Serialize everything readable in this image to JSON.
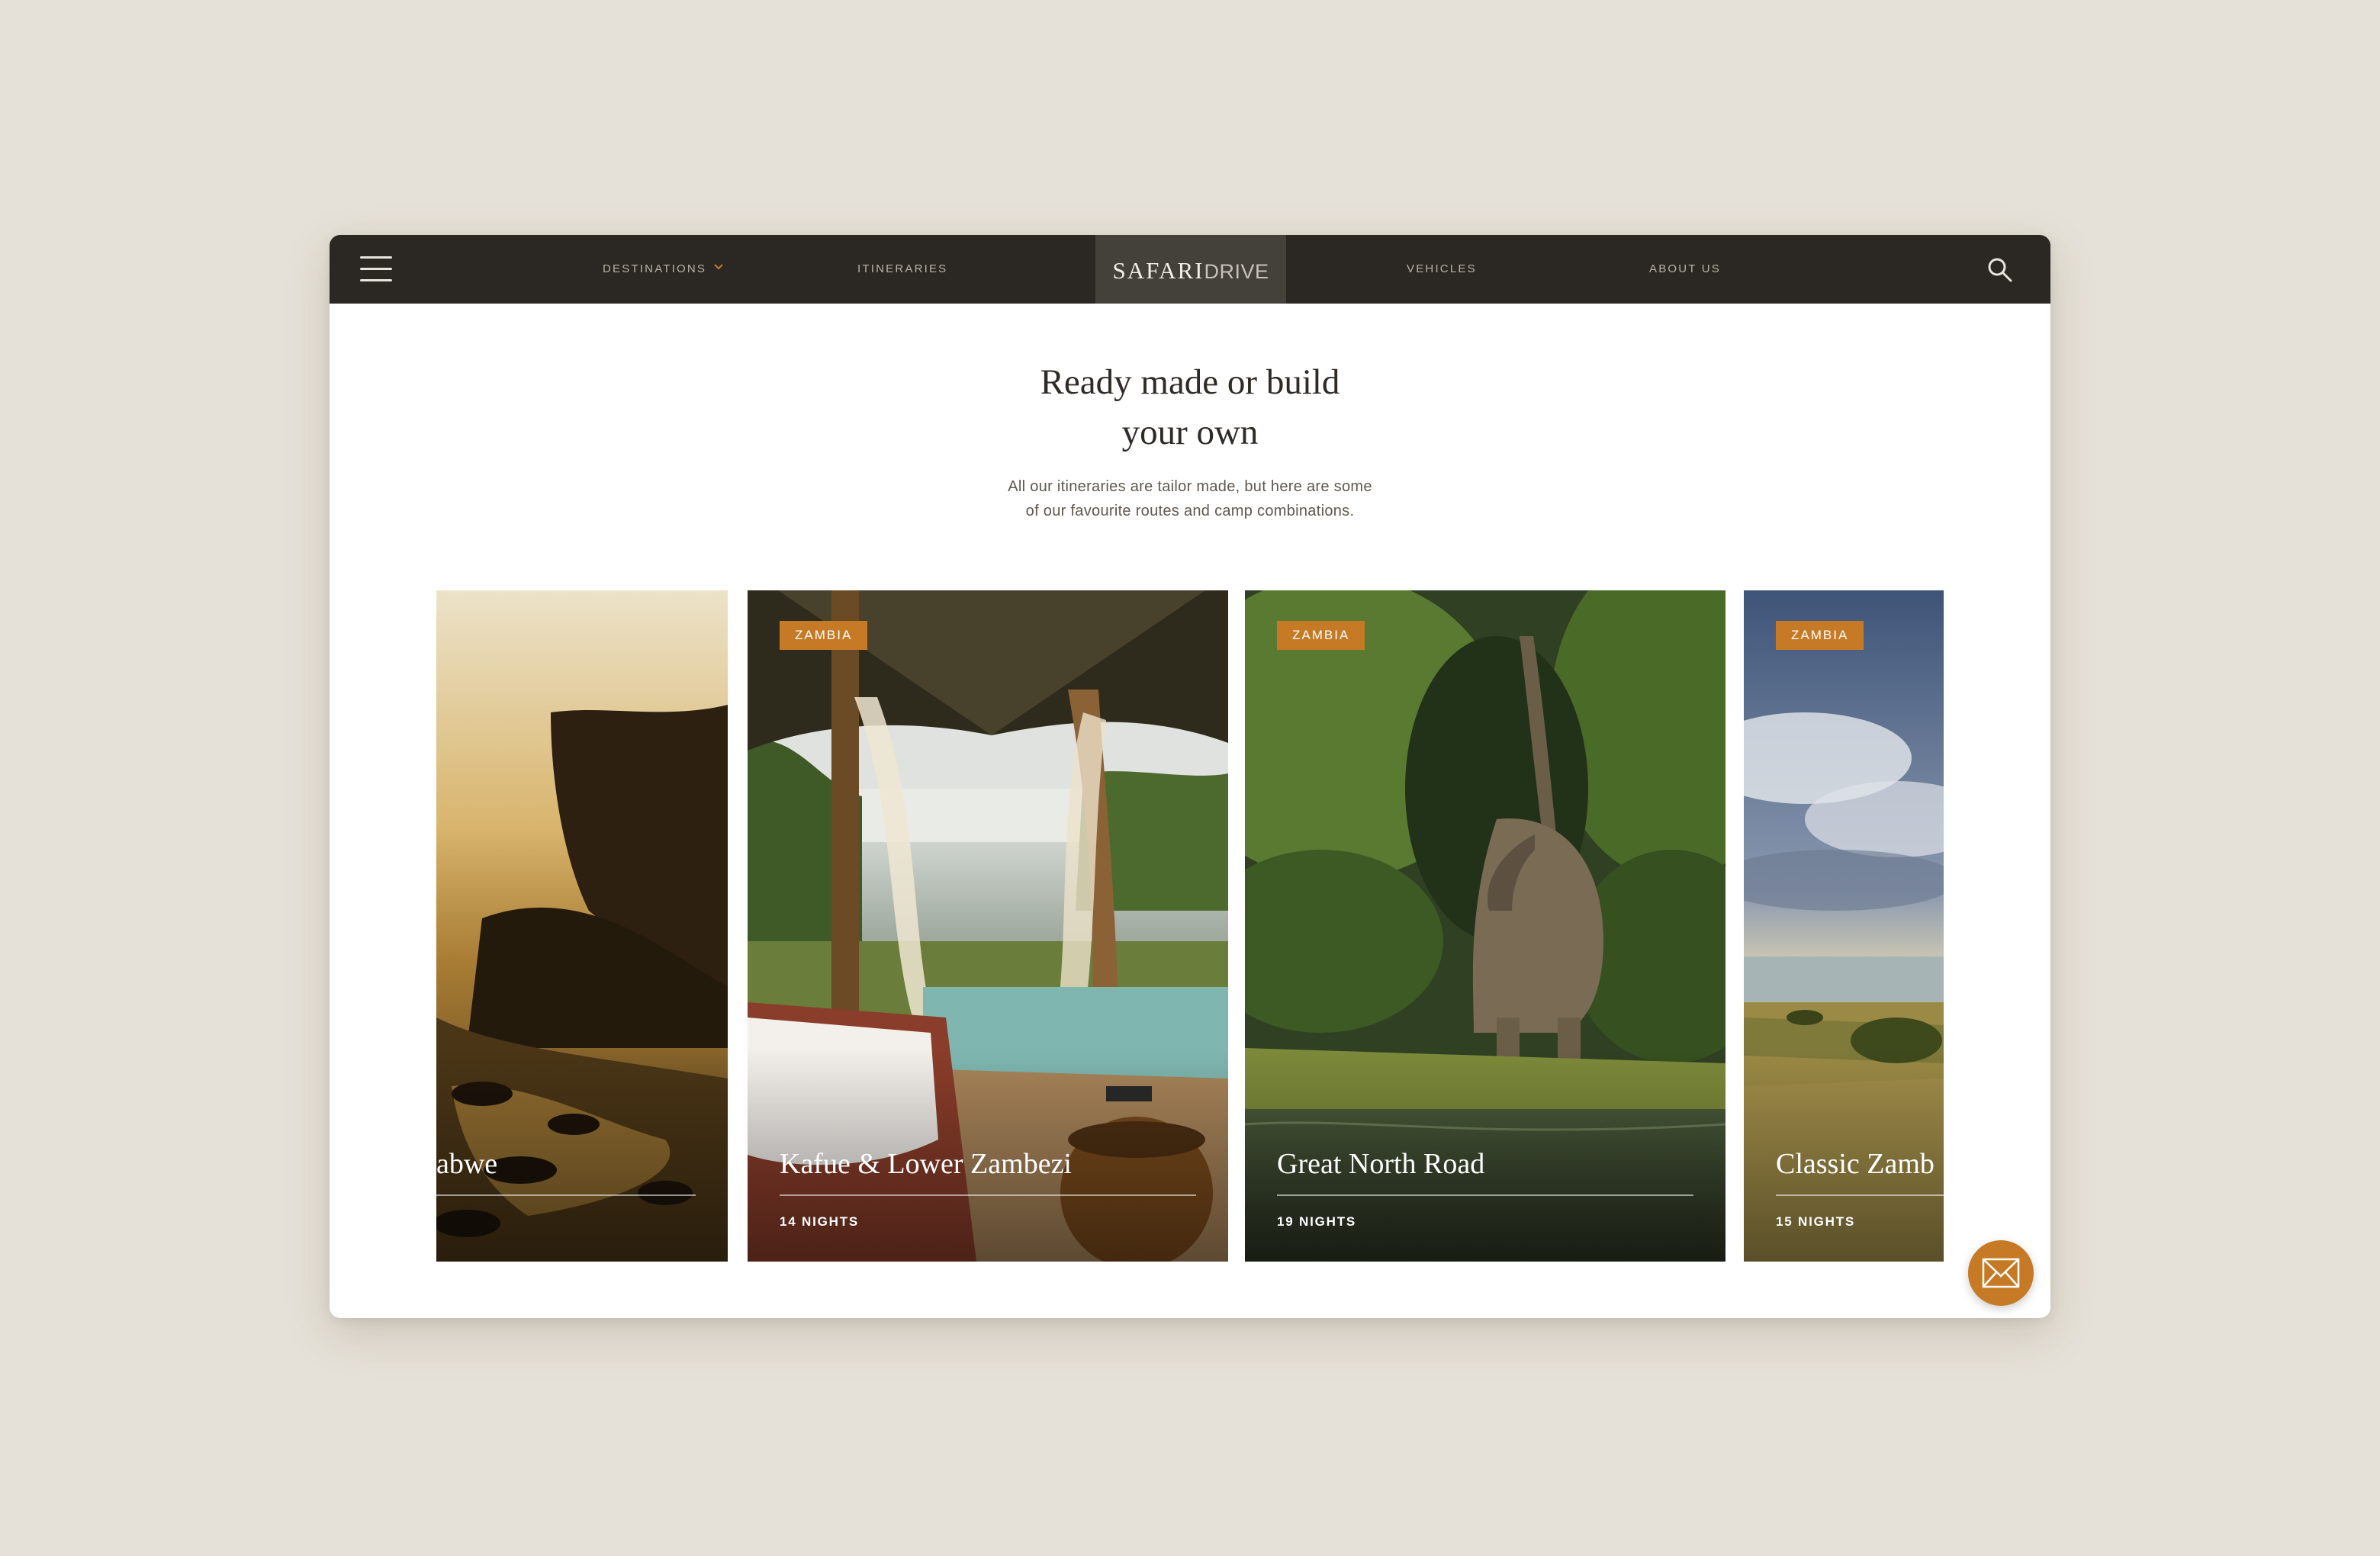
{
  "nav": {
    "links": {
      "destinations": "DESTINATIONS",
      "itineraries": "ITINERARIES",
      "vehicles": "VEHICLES",
      "about": "ABOUT US"
    },
    "logo": {
      "primary": "SAFARI",
      "secondary": "DRIVE"
    }
  },
  "intro": {
    "heading_line1": "Ready made or build",
    "heading_line2": "your own",
    "text_line1": "All our itineraries are tailor made, but here are some",
    "text_line2": "of our favourite routes and camp combinations."
  },
  "itineraries": [
    {
      "title": "abwe",
      "nights": ""
    },
    {
      "badge": "ZAMBIA",
      "title": "Kafue & Lower Zambezi",
      "nights": "14 NIGHTS"
    },
    {
      "badge": "ZAMBIA",
      "title": "Great North Road",
      "nights": "19 NIGHTS"
    },
    {
      "badge": "ZAMBIA",
      "title": "Classic Zamb",
      "nights": "15 NIGHTS"
    }
  ],
  "colors": {
    "page_background": "#e6e1d8",
    "nav_background": "#2b2723",
    "logo_background": "#44403a",
    "accent": "#c67a25"
  },
  "icons": {
    "menu": "hamburger-icon",
    "dropdown": "chevron-down-icon",
    "search": "search-icon",
    "contact": "envelope-icon"
  }
}
